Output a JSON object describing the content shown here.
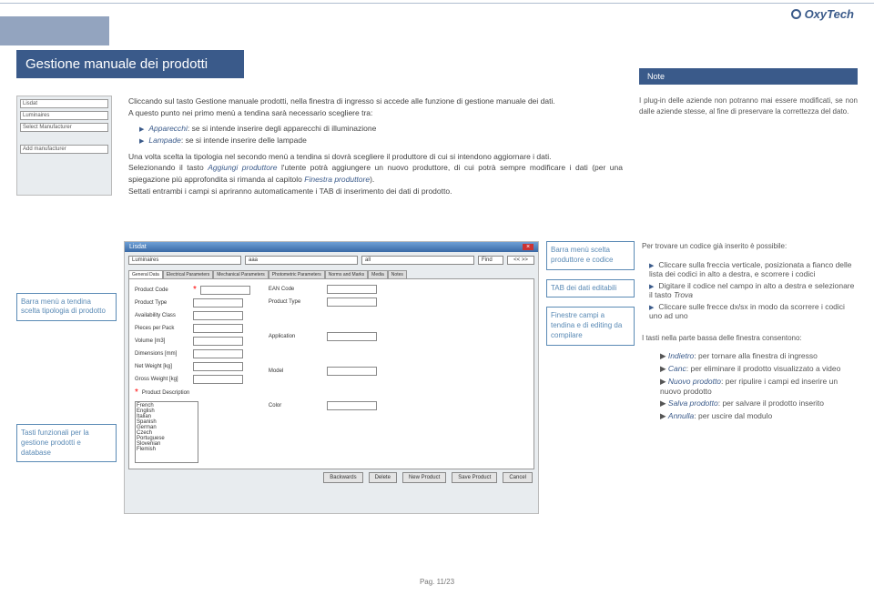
{
  "brand": "OxyTech",
  "page_title": "Gestione manuale dei prodotti",
  "note_label": "Note",
  "pager": "Pag. 11/23",
  "thumb1": {
    "app": "Lisdat",
    "lbl1": "Luminaires",
    "lbl2": "Select Manufacturer",
    "lbl3": "Add manufacturer"
  },
  "intro": {
    "p1": "Cliccando sul tasto Gestione manuale prodotti, nella finestra di ingresso si accede alle funzione di gestione manuale dei dati.",
    "p2": "A questo punto nei primo menù a tendina sarà necessario scegliere tra:",
    "li1a": "Apparecchi",
    "li1b": ": se si intende inserire degli apparecchi di illuminazione",
    "li2a": "Lampade",
    "li2b": ": se si intende inserire delle lampade",
    "p3": "Una volta scelta la tipologia nel secondo menù a tendina si dovrà scegliere il produttore di cui si intendono aggiornare i dati.",
    "p4a": "Selezionando il tasto ",
    "p4i": "Aggiungi produttore",
    "p4b": " l'utente potrà aggiungere un nuovo produttore, di cui potrà sempre modificare i dati (per una spiegazione più approfondita si rimanda al capitolo ",
    "p4i2": "Finestra produttore",
    "p4c": ").",
    "p5": "Settati entrambi i campi si apriranno automaticamente i TAB di inserimento dei dati di prodotto."
  },
  "note1": "I plug-in delle aziende non potranno mai essere modificati, se non dalle aziende stesse, al fine di preservare la correttezza del dato.",
  "ann": {
    "left1": "Barra menù a tendina scelta tipologia di prodotto",
    "left2": "Tasti funzionali per la gestione prodotti e database",
    "mid1": "Barra menù scelta produttore e codice",
    "mid2": "TAB dei dati editabili",
    "mid3": "Finestre campi a tendina e di editing da compilare"
  },
  "notes2": {
    "h1": "Per trovare un codice già inserito è possibile:",
    "n1": "Cliccare sulla freccia verticale, posizionata a fianco delle lista dei codici in alto a destra, e scorrere i codici",
    "n2a": "Digitare il codice nel campo in alto a destra e selezionare il tasto ",
    "n2i": "Trova",
    "n3": "Cliccare sulle frecce dx/sx in modo da scorrere i codici uno ad uno",
    "h2": "I tasti nella parte bassa delle finestra consentono:",
    "m1i": "Indietro",
    "m1": ": per tornare alla finestra di ingresso",
    "m2i": "Canc",
    "m2": ": per eliminare il prodotto visualizzato a video",
    "m3i": "Nuovo prodotto",
    "m3": ": per ripulire i campi ed inserire un nuovo prodotto",
    "m4i": "Salva prodotto",
    "m4": ": per salvare il prodotto inserito",
    "m5i": "Annulla",
    "m5": ": per uscire dal modulo"
  },
  "thumb2": {
    "app": "Lisdat",
    "sel1": "Luminaires",
    "sel2": "aaa",
    "sel3": "all",
    "find": "Find",
    "nav": "<< >>",
    "tabs": [
      "General Data",
      "Electrical Parameters",
      "Mechanical Parameters",
      "Photometric Parameters",
      "Norms and Marks",
      "Media",
      "Notes"
    ],
    "fields_l": [
      "Product Code",
      "Product Type",
      "Availability Class",
      "Pieces per Pack",
      "Volume [m3]",
      "Dimensions [mm]",
      "Net Weight [kg]",
      "Gross Weight [kg]",
      "Product Description"
    ],
    "fields_r": [
      "EAN Code",
      "Product Type",
      "Application",
      "Model",
      "Color"
    ],
    "langs": [
      "French",
      "English",
      "Italian",
      "Spanish",
      "German",
      "Czech",
      "Portuguese",
      "Slovenian",
      "Flemish"
    ],
    "buttons": [
      "Backwards",
      "Delete",
      "New Product",
      "Save Product",
      "Cancel"
    ]
  }
}
